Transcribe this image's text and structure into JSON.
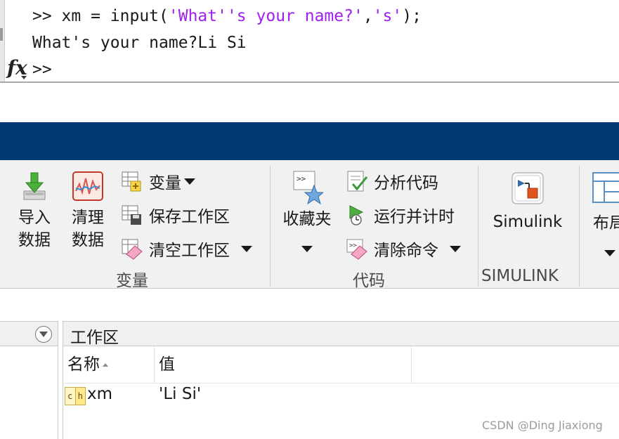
{
  "command_window": {
    "line1": {
      "prompt": ">> xm = input(",
      "arg1": "'What''s your name?'",
      "comma": ",",
      "arg2": "'s'",
      "end": ");"
    },
    "line2": "What's your name?Li Si",
    "prompt": ">>",
    "fx_label": "fx"
  },
  "ribbon": {
    "variable_group": {
      "import_data": [
        "导入",
        "数据"
      ],
      "clean_data": [
        "清理",
        "数据"
      ],
      "new_variable": "变量",
      "save_workspace": "保存工作区",
      "clear_workspace": "清空工作区",
      "label": "变量"
    },
    "code_group": {
      "favorites": "收藏夹",
      "analyze_code": "分析代码",
      "run_and_time": "运行并计时",
      "clear_commands": "清除命令",
      "label": "代码"
    },
    "simulink_group": {
      "simulink_button": "Simulink",
      "label": "SIMULINK"
    },
    "layout_group": {
      "layout_button": "布局"
    }
  },
  "workspace": {
    "title": "工作区",
    "columns": [
      "名称",
      "值"
    ],
    "rows": [
      {
        "icon": [
          "c",
          "h"
        ],
        "name": "xm",
        "value": "'Li Si'"
      }
    ]
  },
  "watermark": "CSDN @Ding Jiaxiong",
  "colors": {
    "title_band": "#003a70",
    "string_literal": "#a020f0",
    "ribbon_bg": "#f1f1f1"
  }
}
